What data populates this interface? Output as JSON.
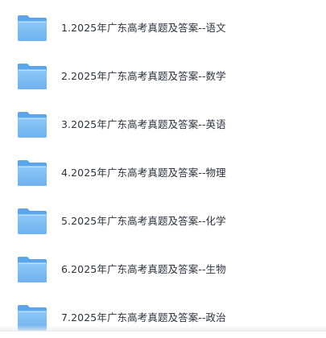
{
  "folders": [
    {
      "label": "1.2025年广东高考真题及答案--语文",
      "icon": "folder-icon"
    },
    {
      "label": "2.2025年广东高考真题及答案--数学",
      "icon": "folder-icon"
    },
    {
      "label": "3.2025年广东高考真题及答案--英语",
      "icon": "folder-icon"
    },
    {
      "label": "4.2025年广东高考真题及答案--物理",
      "icon": "folder-icon"
    },
    {
      "label": "5.2025年广东高考真题及答案--化学",
      "icon": "folder-icon"
    },
    {
      "label": "6.2025年广东高考真题及答案--生物",
      "icon": "folder-icon"
    },
    {
      "label": "7.2025年广东高考真题及答案--政治",
      "icon": "folder-icon"
    }
  ],
  "colors": {
    "folder_back": "#5aa6e8",
    "folder_front": "#8ec8f6",
    "folder_front_dark": "#6fb2ee",
    "text": "#2e3440"
  }
}
